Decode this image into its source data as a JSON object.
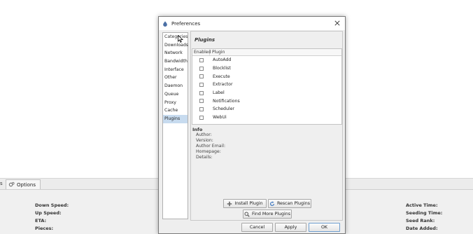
{
  "background": {
    "tab_stub": "s",
    "tab_options": "Options",
    "stats_left": [
      "Down Speed:",
      "Up Speed:",
      "ETA:",
      "Pieces:"
    ],
    "stats_right": [
      "Active Time:",
      "Seeding Time:",
      "Seed Rank:",
      "Date Added:"
    ]
  },
  "dialog": {
    "title": "Preferences",
    "categories_header": "Categories",
    "categories": [
      "Downloads",
      "Network",
      "Bandwidth",
      "Interface",
      "Other",
      "Daemon",
      "Queue",
      "Proxy",
      "Cache",
      "Plugins"
    ],
    "selected_category": "Plugins",
    "section_title": "Plugins",
    "table": {
      "col_enabled": "Enabled",
      "col_plugin": "Plugin",
      "plugins": [
        "AutoAdd",
        "Blocklist",
        "Execute",
        "Extractor",
        "Label",
        "Notifications",
        "Scheduler",
        "WebUi"
      ]
    },
    "info": {
      "title": "Info",
      "fields": [
        "Author:",
        "Version:",
        "Author Email:",
        "Homepage:",
        "Details:"
      ]
    },
    "buttons": {
      "install": "Install Plugin",
      "rescan": "Rescan Plugins",
      "find_more": "Find More Plugins",
      "cancel": "Cancel",
      "apply": "Apply",
      "ok": "OK"
    }
  }
}
